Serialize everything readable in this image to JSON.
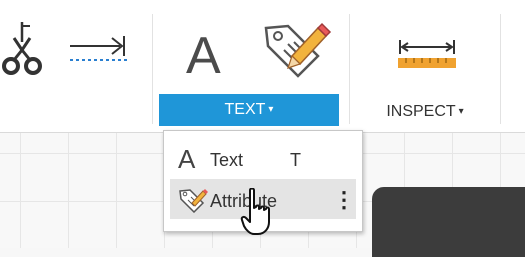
{
  "toolbar": {
    "text_group_label": "TEXT",
    "inspect_group_label": "INSPECT",
    "text_tool_glyph": "A",
    "dropdown_caret": "▾",
    "icons": [
      "scissors-icon",
      "dashed-arrow-icon",
      "text-tool-icon",
      "tag-pencil-icon",
      "measure-ruler-icon"
    ]
  },
  "dropdown": {
    "items": [
      {
        "glyph": "A",
        "label": "Text",
        "shortcut": "T",
        "icon": "text-a-icon"
      },
      {
        "label": "Attribute",
        "icon": "tag-pencil-icon",
        "more": "⋮"
      }
    ]
  },
  "colors": {
    "accent": "#1f96d8",
    "ruler": "#f0a230",
    "dark_panel": "#3c3c3c"
  }
}
